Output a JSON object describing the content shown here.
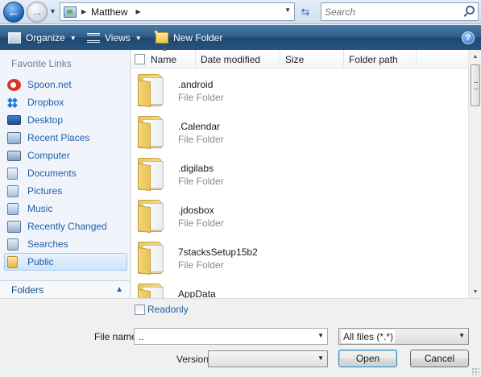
{
  "address_bar": {
    "path_segment": "Matthew",
    "search_placeholder": "Search"
  },
  "toolbar": {
    "organize_label": "Organize",
    "views_label": "Views",
    "new_folder_label": "New Folder",
    "help_label": "?"
  },
  "nav": {
    "heading": "Favorite Links",
    "items": [
      {
        "label": "Spoon.net",
        "icon": "spoon-icon"
      },
      {
        "label": "Dropbox",
        "icon": "dropbox-icon"
      },
      {
        "label": "Desktop",
        "icon": "desktop-icon"
      },
      {
        "label": "Recent Places",
        "icon": "recent-places-icon"
      },
      {
        "label": "Computer",
        "icon": "computer-icon"
      },
      {
        "label": "Documents",
        "icon": "documents-icon"
      },
      {
        "label": "Pictures",
        "icon": "pictures-icon"
      },
      {
        "label": "Music",
        "icon": "music-icon"
      },
      {
        "label": "Recently Changed",
        "icon": "recently-changed-icon"
      },
      {
        "label": "Searches",
        "icon": "searches-icon"
      },
      {
        "label": "Public",
        "icon": "public-folder-icon",
        "selected": true
      }
    ],
    "folders_label": "Folders"
  },
  "columns": {
    "name": "Name",
    "date_modified": "Date modified",
    "size": "Size",
    "folder_path": "Folder path"
  },
  "files": [
    {
      "name": ".android",
      "type": "File Folder"
    },
    {
      "name": ".Calendar",
      "type": "File Folder"
    },
    {
      "name": ".digilabs",
      "type": "File Folder"
    },
    {
      "name": ".jdosbox",
      "type": "File Folder"
    },
    {
      "name": "7stacksSetup15b2",
      "type": "File Folder"
    },
    {
      "name": "AppData",
      "type": ""
    }
  ],
  "bottom": {
    "readonly_label": "Readonly",
    "file_name_label": "File name:",
    "file_name_value": "..",
    "filter_value": "All files (*.*)",
    "version_label": "Version",
    "version_value": "",
    "open_label": "Open",
    "cancel_label": "Cancel"
  },
  "colors": {
    "toolbar": "#2b5a84",
    "link_blue": "#1d5ea8",
    "selected_nav": "#cfe4fa"
  }
}
